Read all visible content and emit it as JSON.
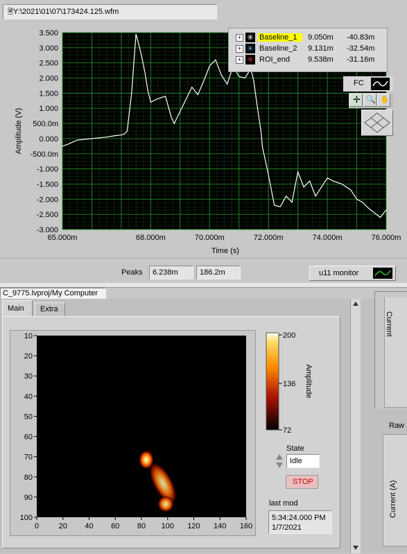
{
  "file_path": "Y:\\2021\\01\\07\\173424.125.wfm",
  "waveform": {
    "x_label": "Time (s)",
    "y_label": "Amplitude (V)",
    "x_ticks": [
      "65.000m",
      "68.000m",
      "70.000m",
      "72.000m",
      "74.000m",
      "76.000m"
    ],
    "y_ticks": [
      "3.500",
      "3.000",
      "2.500",
      "2.000",
      "1.500",
      "1.000",
      "500.0m",
      "0.000",
      "-500.0m",
      "-1.000",
      "-1.500",
      "-2.000",
      "-2.500",
      "-3.000"
    ],
    "cursors": [
      {
        "name": "Baseline_1",
        "x": "9.050m",
        "y": "-40.83m",
        "color": "#ffffff"
      },
      {
        "name": "Baseline_2",
        "x": "9.131m",
        "y": "-32.54m",
        "color": "#4aa0e0"
      },
      {
        "name": "ROI_end",
        "x": "9.538m",
        "y": "-31.16m",
        "color": "#e03030"
      }
    ],
    "fc_label": "FC",
    "plot_bg": "#000000",
    "grid_color": "#2a9a2a",
    "trace_color": "#ffffff"
  },
  "peaks": {
    "label": "Peaks",
    "value1": "6.238m",
    "value2": "186.2m"
  },
  "monitor_button": "u11 monitor",
  "project_bar": "C_9775.lvproj/My Computer",
  "tabs": [
    {
      "label": "Main"
    },
    {
      "label": "Extra"
    }
  ],
  "heatmap": {
    "x_ticks": [
      "0",
      "20",
      "40",
      "60",
      "80",
      "100",
      "120",
      "140",
      "160"
    ],
    "y_ticks": [
      "10",
      "20",
      "30",
      "40",
      "50",
      "60",
      "70",
      "80",
      "90",
      "100"
    ],
    "colorbar_label": "Amplitude",
    "colorbar_ticks": [
      "200",
      "136",
      "72"
    ]
  },
  "state": {
    "label": "State",
    "value": "Idle"
  },
  "stop_button": "STOP",
  "last_mod": {
    "label": "last mod",
    "time": "5:34:24.000 PM",
    "date": "1/7/2021"
  },
  "right_panel": {
    "current_top": "Current",
    "raw_label": "Raw",
    "current_a": "Current (A)"
  },
  "chart_data": {
    "type": "line",
    "x_label": "Time (s)",
    "y_label": "Amplitude (V)",
    "xlim": [
      65.0,
      76.0
    ],
    "ylim": [
      -3.0,
      3.5
    ],
    "x_unit_scale": "m",
    "x": [
      65.0,
      65.2,
      65.5,
      66.0,
      66.5,
      66.8,
      67.0,
      67.1,
      67.2,
      67.35,
      67.5,
      67.65,
      67.8,
      67.9,
      68.0,
      68.2,
      68.5,
      68.7,
      68.8,
      69.0,
      69.2,
      69.4,
      69.6,
      69.8,
      70.0,
      70.2,
      70.4,
      70.6,
      70.8,
      71.0,
      71.2,
      71.4,
      71.5,
      71.6,
      71.75,
      71.8,
      72.0,
      72.2,
      72.4,
      72.6,
      72.8,
      73.0,
      73.2,
      73.4,
      73.6,
      73.8,
      74.0,
      74.2,
      74.5,
      74.8,
      75.0,
      75.2,
      75.4,
      75.6,
      75.8,
      76.0
    ],
    "y": [
      -0.25,
      -0.18,
      -0.05,
      0.0,
      0.05,
      0.1,
      0.12,
      0.15,
      0.25,
      1.5,
      3.45,
      2.9,
      2.2,
      1.6,
      1.2,
      1.3,
      1.4,
      0.7,
      0.5,
      0.9,
      1.3,
      1.7,
      1.45,
      1.9,
      2.4,
      2.6,
      2.1,
      1.8,
      2.4,
      2.05,
      2.0,
      2.3,
      1.9,
      1.2,
      0.2,
      -0.3,
      -1.2,
      -2.2,
      -2.25,
      -1.9,
      -2.1,
      -1.1,
      -1.6,
      -1.4,
      -1.9,
      -1.6,
      -1.3,
      -1.4,
      -1.5,
      -1.7,
      -2.0,
      -2.1,
      -2.3,
      -2.45,
      -2.6,
      -2.35
    ]
  }
}
